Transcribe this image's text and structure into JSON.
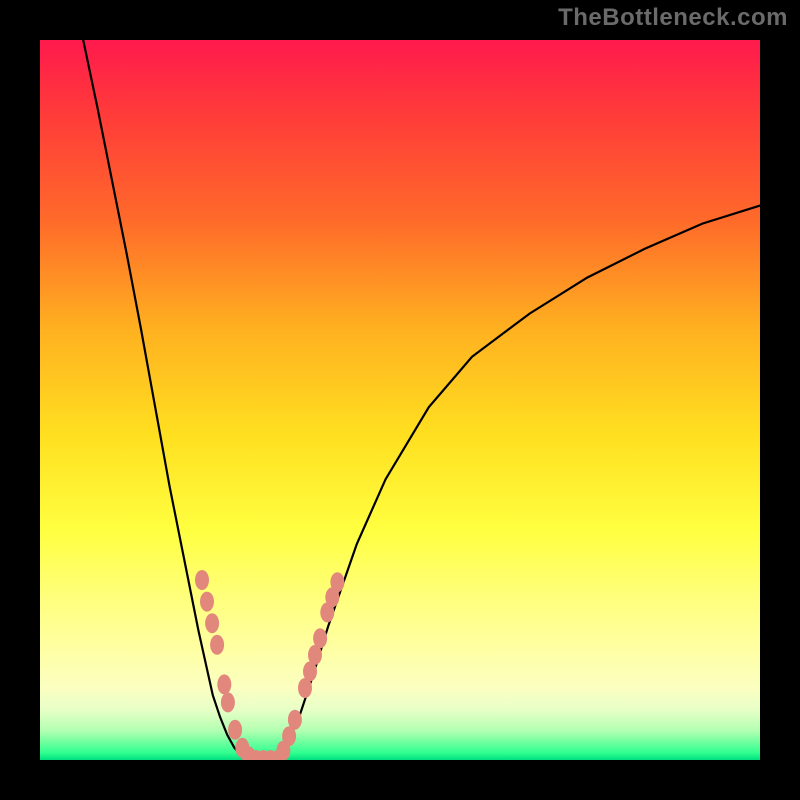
{
  "watermark": "TheBottleneck.com",
  "colors": {
    "frame": "#000000",
    "curve": "#000000",
    "bead": "#e2877c",
    "gradient_top": "#ff1a4d",
    "gradient_bottom": "#00e080"
  },
  "chart_data": {
    "type": "line",
    "title": "",
    "xlabel": "",
    "ylabel": "",
    "xlim": [
      0,
      100
    ],
    "ylim": [
      0,
      100
    ],
    "note": "No axes/ticks rendered; x is horizontal position 0–100, y is height 0–100 (0 = bottom). Values estimated from pixel positions.",
    "series": [
      {
        "name": "left-curve",
        "x": [
          6,
          8,
          10,
          12,
          14,
          16,
          18,
          20,
          22,
          24,
          25,
          26,
          27,
          28,
          29
        ],
        "y": [
          100,
          90.5,
          80.5,
          70.5,
          60,
          49,
          38,
          28,
          18,
          9,
          6,
          3.5,
          1.7,
          0.6,
          0
        ]
      },
      {
        "name": "right-curve",
        "x": [
          33,
          34,
          36,
          38,
          40,
          44,
          48,
          54,
          60,
          68,
          76,
          84,
          92,
          100
        ],
        "y": [
          0,
          1.5,
          6,
          12,
          18.5,
          30,
          39,
          49,
          56,
          62,
          67,
          71,
          74.5,
          77
        ]
      },
      {
        "name": "valley-floor",
        "x": [
          29,
          30,
          31,
          32,
          33
        ],
        "y": [
          0,
          0,
          0,
          0,
          0
        ]
      }
    ],
    "markers": {
      "name": "beads",
      "points": [
        {
          "x": 22.5,
          "y": 25.0
        },
        {
          "x": 23.2,
          "y": 22.0
        },
        {
          "x": 23.9,
          "y": 19.0
        },
        {
          "x": 24.6,
          "y": 16.0
        },
        {
          "x": 25.6,
          "y": 10.5
        },
        {
          "x": 26.1,
          "y": 8.0
        },
        {
          "x": 27.1,
          "y": 4.2
        },
        {
          "x": 28.1,
          "y": 1.7
        },
        {
          "x": 29.0,
          "y": 0.5
        },
        {
          "x": 30.0,
          "y": 0.0
        },
        {
          "x": 31.0,
          "y": 0.0
        },
        {
          "x": 32.0,
          "y": 0.0
        },
        {
          "x": 33.0,
          "y": 0.0
        },
        {
          "x": 33.8,
          "y": 1.3
        },
        {
          "x": 34.6,
          "y": 3.3
        },
        {
          "x": 35.4,
          "y": 5.6
        },
        {
          "x": 36.8,
          "y": 10.0
        },
        {
          "x": 37.5,
          "y": 12.3
        },
        {
          "x": 38.2,
          "y": 14.6
        },
        {
          "x": 38.9,
          "y": 16.9
        },
        {
          "x": 39.9,
          "y": 20.5
        },
        {
          "x": 40.6,
          "y": 22.6
        },
        {
          "x": 41.3,
          "y": 24.7
        }
      ]
    }
  }
}
